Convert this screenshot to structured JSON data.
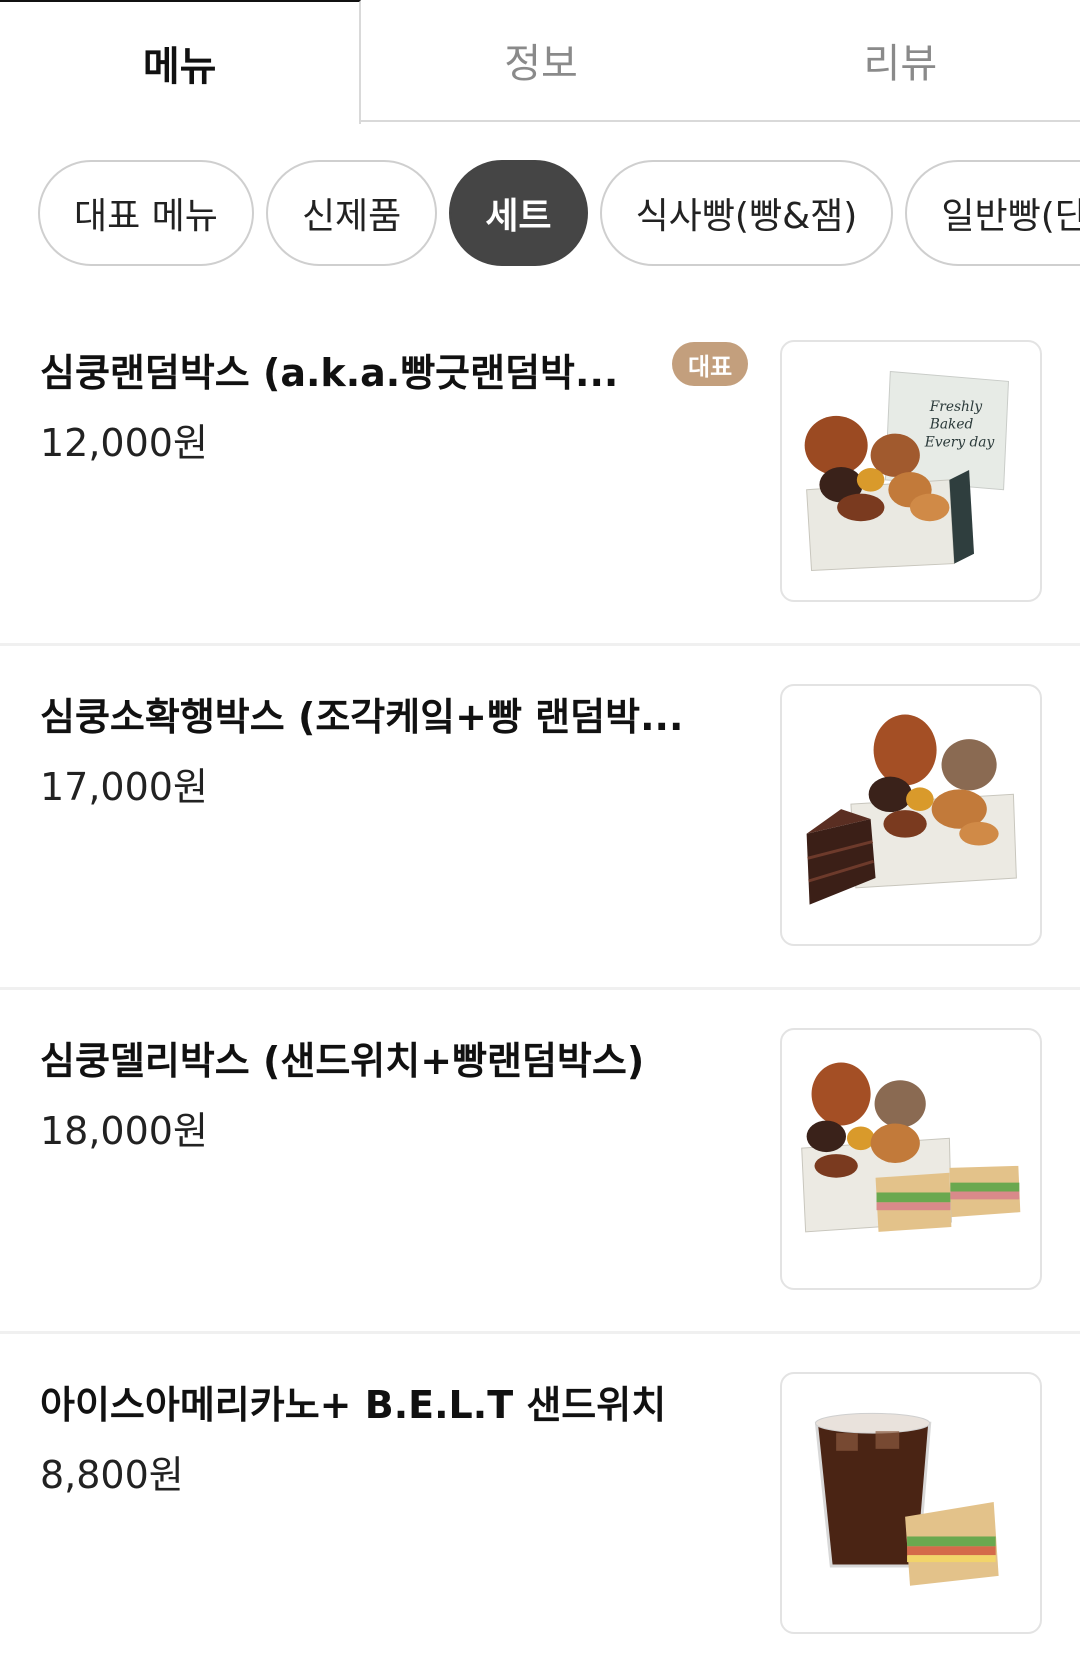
{
  "tabs": [
    {
      "label": "메뉴",
      "active": true
    },
    {
      "label": "정보",
      "active": false
    },
    {
      "label": "리뷰",
      "active": false
    }
  ],
  "categories": [
    {
      "label": "대표 메뉴",
      "active": false
    },
    {
      "label": "신제품",
      "active": false
    },
    {
      "label": "세트",
      "active": true
    },
    {
      "label": "식사빵(빵&잼)",
      "active": false
    },
    {
      "label": "일반빵(단팥",
      "active": false
    }
  ],
  "items": [
    {
      "name": "심쿵랜덤박스 (a.k.a.빵긋랜덤박...",
      "price": "12,000원",
      "badge": "대표",
      "image": "bread-box-image"
    },
    {
      "name": "심쿵소확행박스 (조각케잌+빵 랜덤박...",
      "price": "17,000원",
      "image": "cake-bread-box-image"
    },
    {
      "name": "심쿵델리박스 (샌드위치+빵랜덤박스)",
      "price": "18,000원",
      "image": "sandwich-bread-box-image"
    },
    {
      "name": "아이스아메리카노+ B.E.L.T 샌드위치",
      "price": "8,800원",
      "image": "coffee-sandwich-image"
    }
  ],
  "colors": {
    "active_chip": "#454545",
    "badge": "#c39f7d",
    "divider": "#f0f0f0"
  }
}
